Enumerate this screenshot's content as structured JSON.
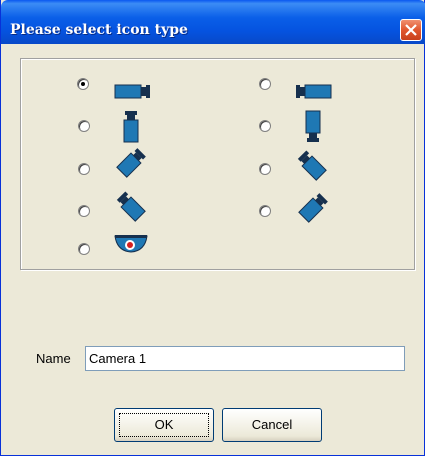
{
  "dialog": {
    "title": "Please select icon type",
    "close_icon": "close-icon"
  },
  "icon_options": [
    {
      "id": "camera-right",
      "icon": "camera-right-icon",
      "selected": true
    },
    {
      "id": "camera-left",
      "icon": "camera-left-icon",
      "selected": false
    },
    {
      "id": "camera-down",
      "icon": "camera-down-icon",
      "selected": false
    },
    {
      "id": "camera-up",
      "icon": "camera-up-icon",
      "selected": false
    },
    {
      "id": "camera-diag-down-left",
      "icon": "camera-diag-down-left-icon",
      "selected": false
    },
    {
      "id": "camera-diag-down-right",
      "icon": "camera-diag-down-right-icon",
      "selected": false
    },
    {
      "id": "camera-diag-down-right-2",
      "icon": "camera-diag-down-right-icon",
      "selected": false
    },
    {
      "id": "camera-diag-down-left-2",
      "icon": "camera-diag-down-left-icon",
      "selected": false
    },
    {
      "id": "dome-camera",
      "icon": "dome-camera-icon",
      "selected": false
    }
  ],
  "name_field": {
    "label": "Name",
    "value": "Camera 1"
  },
  "buttons": {
    "ok_label": "OK",
    "cancel_label": "Cancel"
  },
  "colors": {
    "titlebar": "#0a5fe8",
    "camera_body": "#1f78b4",
    "camera_dark": "#16304e",
    "dialog_bg": "#ece9d8"
  }
}
